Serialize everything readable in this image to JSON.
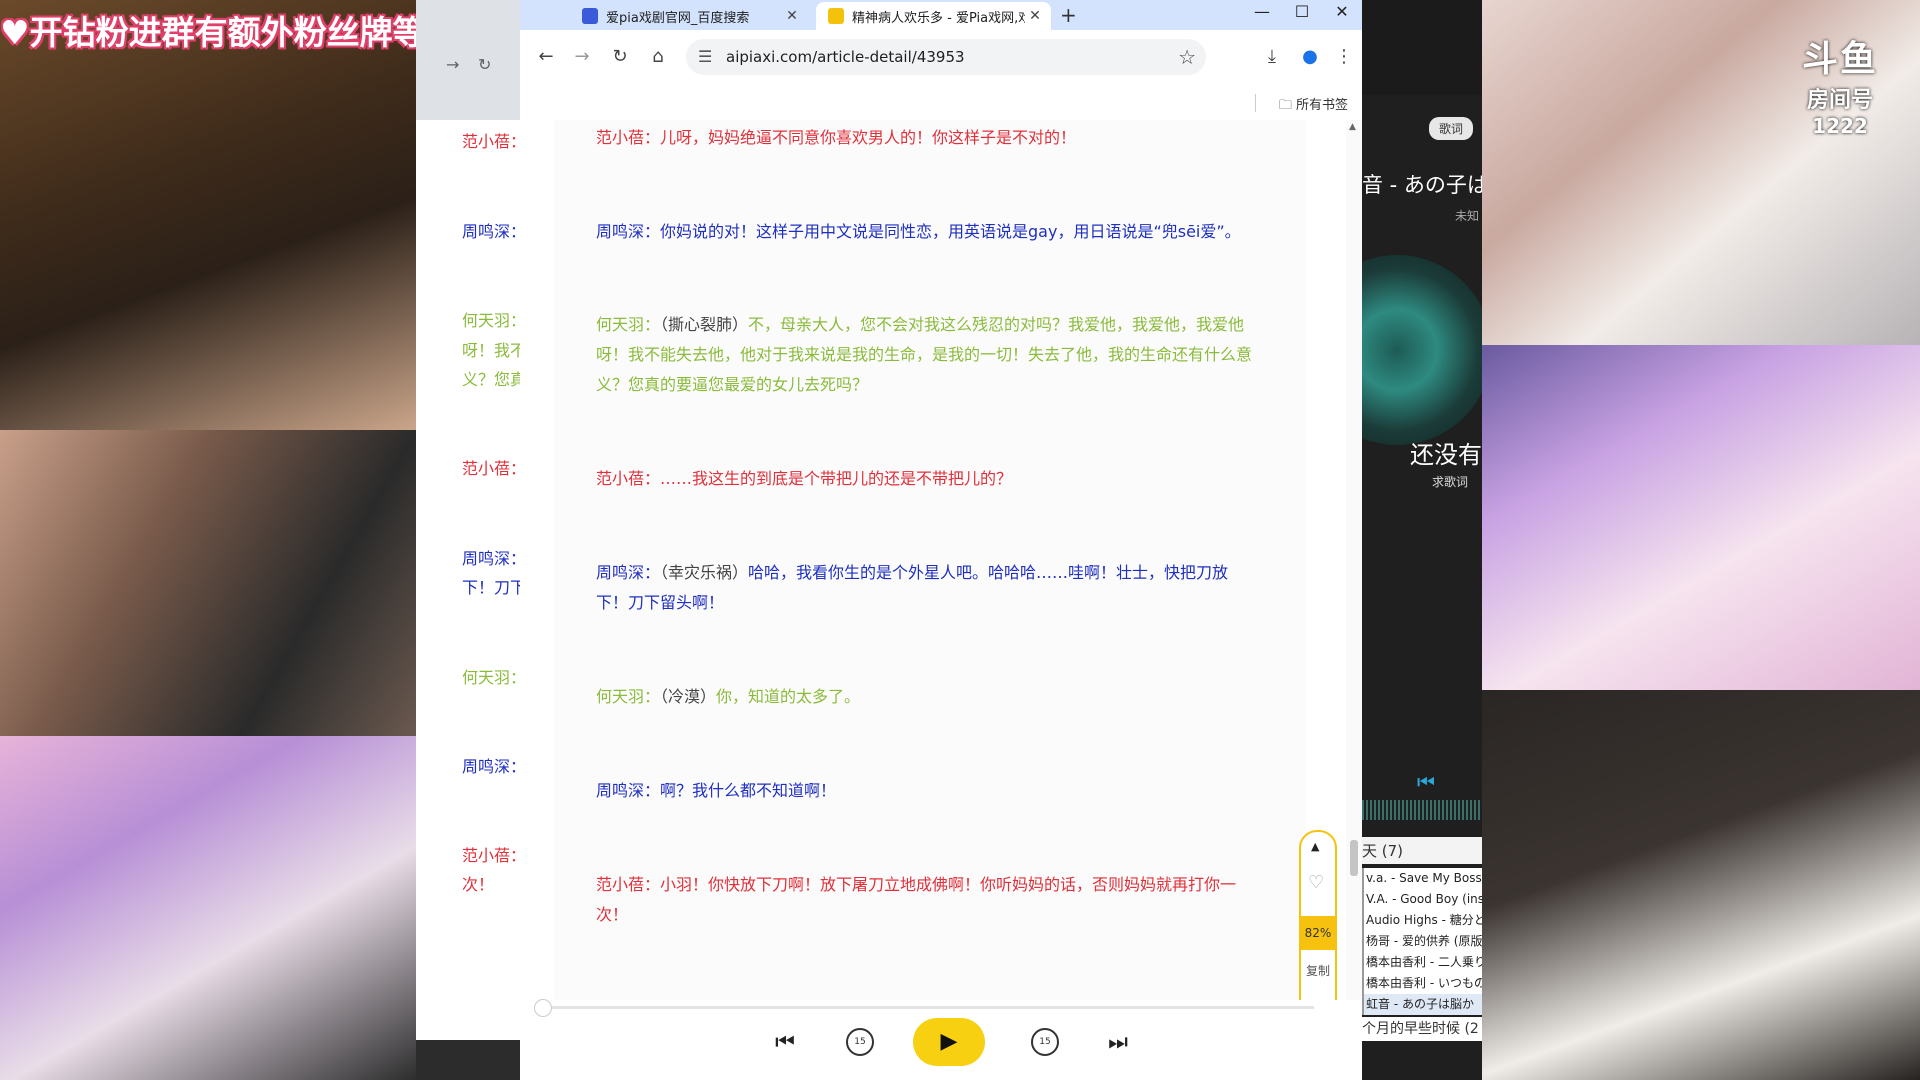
{
  "overlay": {
    "banner": "♥开钻粉进群有额外粉丝牌等级福利♥",
    "brand_logo": "斗鱼",
    "brand_sub": "房间号",
    "room_number": "1222"
  },
  "music_player": {
    "lyric_tag": "歌词",
    "song_title": "音 - あの子は",
    "artist": "未知",
    "no_lyrics": "还没有",
    "find_lyrics": "求歌词",
    "playlist_header": "天 (7)",
    "playlist": [
      "v.a. - Save My Boss",
      "V.A. - Good Boy (ins",
      "Audio Highs - 糖分と",
      "杨哥 - 爱的供养 (原版",
      "橋本由香利 - 二人乗り",
      "橋本由香利 - いつもの",
      "虹音 - あの子は脳か"
    ],
    "next_hint": "个月的早些时候 (2"
  },
  "background_window": {
    "lines": [
      {
        "text": "范小蓓：",
        "color": "red"
      },
      {
        "text": "周鸣深：",
        "color": "blue"
      },
      {
        "text": "何天羽：",
        "color": "green"
      },
      {
        "text": "呀！我不",
        "color": "green"
      },
      {
        "text": "义？您真",
        "color": "green"
      },
      {
        "text": "范小蓓：",
        "color": "red"
      },
      {
        "text": "周鸣深：",
        "color": "blue"
      },
      {
        "text": "下！刀下",
        "color": "blue"
      },
      {
        "text": "何天羽：",
        "color": "green"
      },
      {
        "text": "周鸣深：",
        "color": "blue"
      },
      {
        "text": "范小蓓：",
        "color": "red"
      },
      {
        "text": "次！",
        "color": "red"
      }
    ]
  },
  "browser": {
    "tabs": [
      {
        "title": "爱pia戏剧官网_百度搜索",
        "active": false
      },
      {
        "title": "精神病人欢乐多 - 爱Pia戏网,戏",
        "active": true
      }
    ],
    "url": "aipiaxi.com/article-detail/43953",
    "bookmarks_all": "所有书签"
  },
  "script": {
    "l1": {
      "speaker": "范小蓓：",
      "text": "儿呀，妈妈绝逼不同意你喜欢男人的！你这样子是不对的！"
    },
    "l2": {
      "speaker": "周鸣深：",
      "text": "你妈说的对！这样子用中文说是同性恋，用英语说是gay，用日语说是“兜sēi爱”。"
    },
    "l3": {
      "speaker": "何天羽：",
      "stage": "（撕心裂肺）",
      "text1": "不，母亲大人，您不会对我这么残忍的对吗？我爱他，我爱他，我爱他",
      "text2": "呀！我不能失去他，他对于我来说是我的生命，是我的一切！失去了他，我的生命还有什么意",
      "text3": "义？您真的要逼您最爱的女儿去死吗？"
    },
    "l4": {
      "speaker": "范小蓓：",
      "text": "……我这生的到底是个带把儿的还是不带把儿的？"
    },
    "l5": {
      "speaker": "周鸣深：",
      "stage": "（幸灾乐祸）",
      "text1": "哈哈，我看你生的是个外星人吧。哈哈哈……哇啊！壮士，快把刀放",
      "text2": "下！刀下留头啊！"
    },
    "l6": {
      "speaker": "何天羽：",
      "stage": "（冷漠）",
      "text": "你，知道的太多了。"
    },
    "l7": {
      "speaker": "周鸣深：",
      "text": "啊？我什么都不知道啊！"
    },
    "l8": {
      "speaker": "范小蓓：",
      "text1": "小羽！你快放下刀啊！放下屠刀立地成佛啊！你听妈妈的话，否则妈妈就再打你一",
      "text2": "次！"
    }
  },
  "side_panel": {
    "progress_fraction": 0.82,
    "progress_label": "82%",
    "copy_label": "复制"
  },
  "player": {
    "playback_fraction": 0.0,
    "rewind_label": "15",
    "forward_label": "15"
  }
}
